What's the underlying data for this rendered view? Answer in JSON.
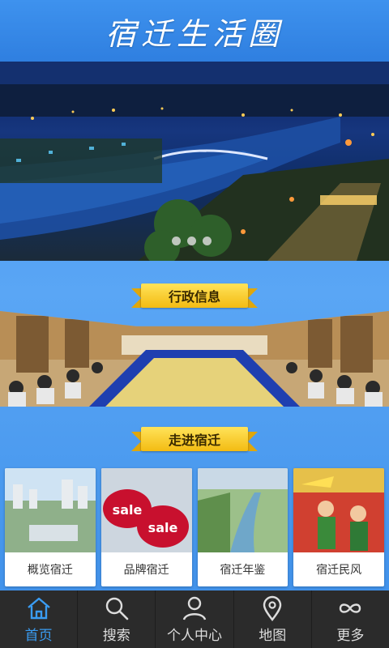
{
  "header": {
    "title": "宿迁生活圈"
  },
  "banner": {
    "dots": 3
  },
  "sections": {
    "admin": {
      "label": "行政信息"
    },
    "intro": {
      "label": "走进宿迁"
    }
  },
  "cards": [
    {
      "label": "概览宿迁",
      "icon": "city-photo"
    },
    {
      "label": "品牌宿迁",
      "icon": "sale-tags-photo"
    },
    {
      "label": "宿迁年鉴",
      "icon": "canal-photo"
    },
    {
      "label": "宿迁民风",
      "icon": "folk-performance-photo"
    }
  ],
  "tabs": [
    {
      "label": "首页",
      "icon": "home-icon",
      "active": true
    },
    {
      "label": "搜索",
      "icon": "search-icon"
    },
    {
      "label": "个人中心",
      "icon": "user-icon"
    },
    {
      "label": "地图",
      "icon": "map-pin-icon"
    },
    {
      "label": "更多",
      "icon": "more-icon"
    }
  ],
  "colors": {
    "accent": "#3a9cf2",
    "header": "#3e92ee",
    "ribbon": "#f3c11b",
    "tabbar": "#2b2b2b"
  }
}
